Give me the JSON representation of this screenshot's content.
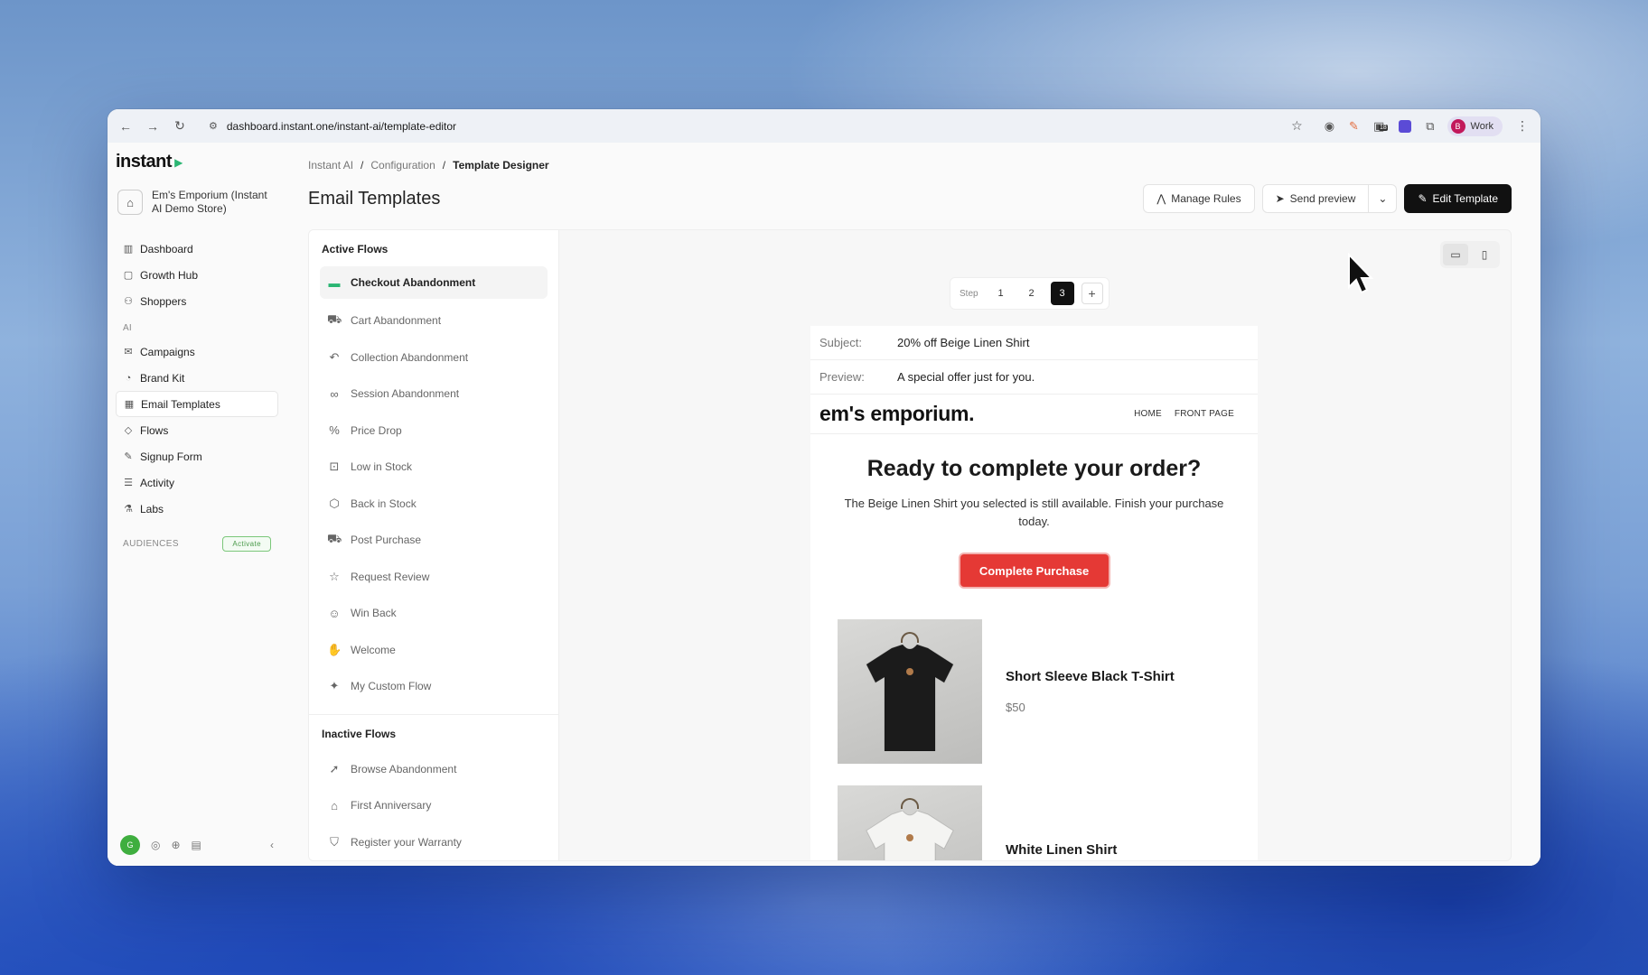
{
  "browser": {
    "url": "dashboard.instant.one/instant-ai/template-editor",
    "profile_label": "Work",
    "profile_initial": "B",
    "ext_badge": "18"
  },
  "sidebar": {
    "logo": "instant",
    "store_name": "Em's Emporium (Instant AI Demo Store)",
    "items_top": [
      {
        "label": "Dashboard",
        "icon": "chart-icon"
      },
      {
        "label": "Growth Hub",
        "icon": "chat-icon"
      },
      {
        "label": "Shoppers",
        "icon": "users-icon"
      }
    ],
    "section_ai": "AI",
    "items_ai": [
      {
        "label": "Campaigns",
        "icon": "mail-icon"
      },
      {
        "label": "Brand Kit",
        "icon": "palette-icon"
      },
      {
        "label": "Email Templates",
        "icon": "template-icon",
        "active": true
      },
      {
        "label": "Flows",
        "icon": "flow-icon"
      },
      {
        "label": "Signup Form",
        "icon": "form-icon"
      },
      {
        "label": "Activity",
        "icon": "activity-icon"
      },
      {
        "label": "Labs",
        "icon": "flask-icon"
      }
    ],
    "audiences_label": "AUDIENCES",
    "activate_label": "Activate",
    "footer_avatar": "G"
  },
  "header": {
    "breadcrumb": [
      "Instant AI",
      "Configuration",
      "Template Designer"
    ],
    "title": "Email Templates",
    "manage_rules": "Manage Rules",
    "send_preview": "Send preview",
    "edit_template": "Edit Template"
  },
  "flows": {
    "active_heading": "Active Flows",
    "active": [
      {
        "label": "Checkout Abandonment",
        "icon": "card-icon",
        "selected": true
      },
      {
        "label": "Cart Abandonment",
        "icon": "cart-icon"
      },
      {
        "label": "Collection Abandonment",
        "icon": "undo-icon"
      },
      {
        "label": "Session Abandonment",
        "icon": "binoculars-icon"
      },
      {
        "label": "Price Drop",
        "icon": "percent-icon"
      },
      {
        "label": "Low in Stock",
        "icon": "box-down-icon"
      },
      {
        "label": "Back in Stock",
        "icon": "package-icon"
      },
      {
        "label": "Post Purchase",
        "icon": "truck-icon"
      },
      {
        "label": "Request Review",
        "icon": "star-icon"
      },
      {
        "label": "Win Back",
        "icon": "smile-icon"
      },
      {
        "label": "Welcome",
        "icon": "wave-icon"
      },
      {
        "label": "My Custom Flow",
        "icon": "sparkle-icon"
      }
    ],
    "inactive_heading": "Inactive Flows",
    "inactive": [
      {
        "label": "Browse Abandonment",
        "icon": "pointer-icon"
      },
      {
        "label": "First Anniversary",
        "icon": "cake-icon"
      },
      {
        "label": "Register your Warranty",
        "icon": "shield-icon"
      }
    ]
  },
  "editor": {
    "step_label": "Step",
    "steps": [
      "1",
      "2",
      "3"
    ],
    "active_step": "3",
    "add_step": "+"
  },
  "email": {
    "subject_label": "Subject:",
    "subject": "20% off Beige Linen Shirt",
    "preview_label": "Preview:",
    "preview": "A special offer just for you.",
    "brand": "em's emporium.",
    "nav": [
      "HOME",
      "FRONT PAGE"
    ],
    "headline": "Ready to complete your order?",
    "body": "The Beige Linen Shirt you selected is still available. Finish your purchase today.",
    "cta": "Complete Purchase",
    "products": [
      {
        "name": "Short Sleeve Black T-Shirt",
        "price": "$50",
        "color": "#1b1b1b"
      },
      {
        "name": "White Linen Shirt",
        "price": "",
        "color": "#f4f4f2"
      }
    ]
  }
}
